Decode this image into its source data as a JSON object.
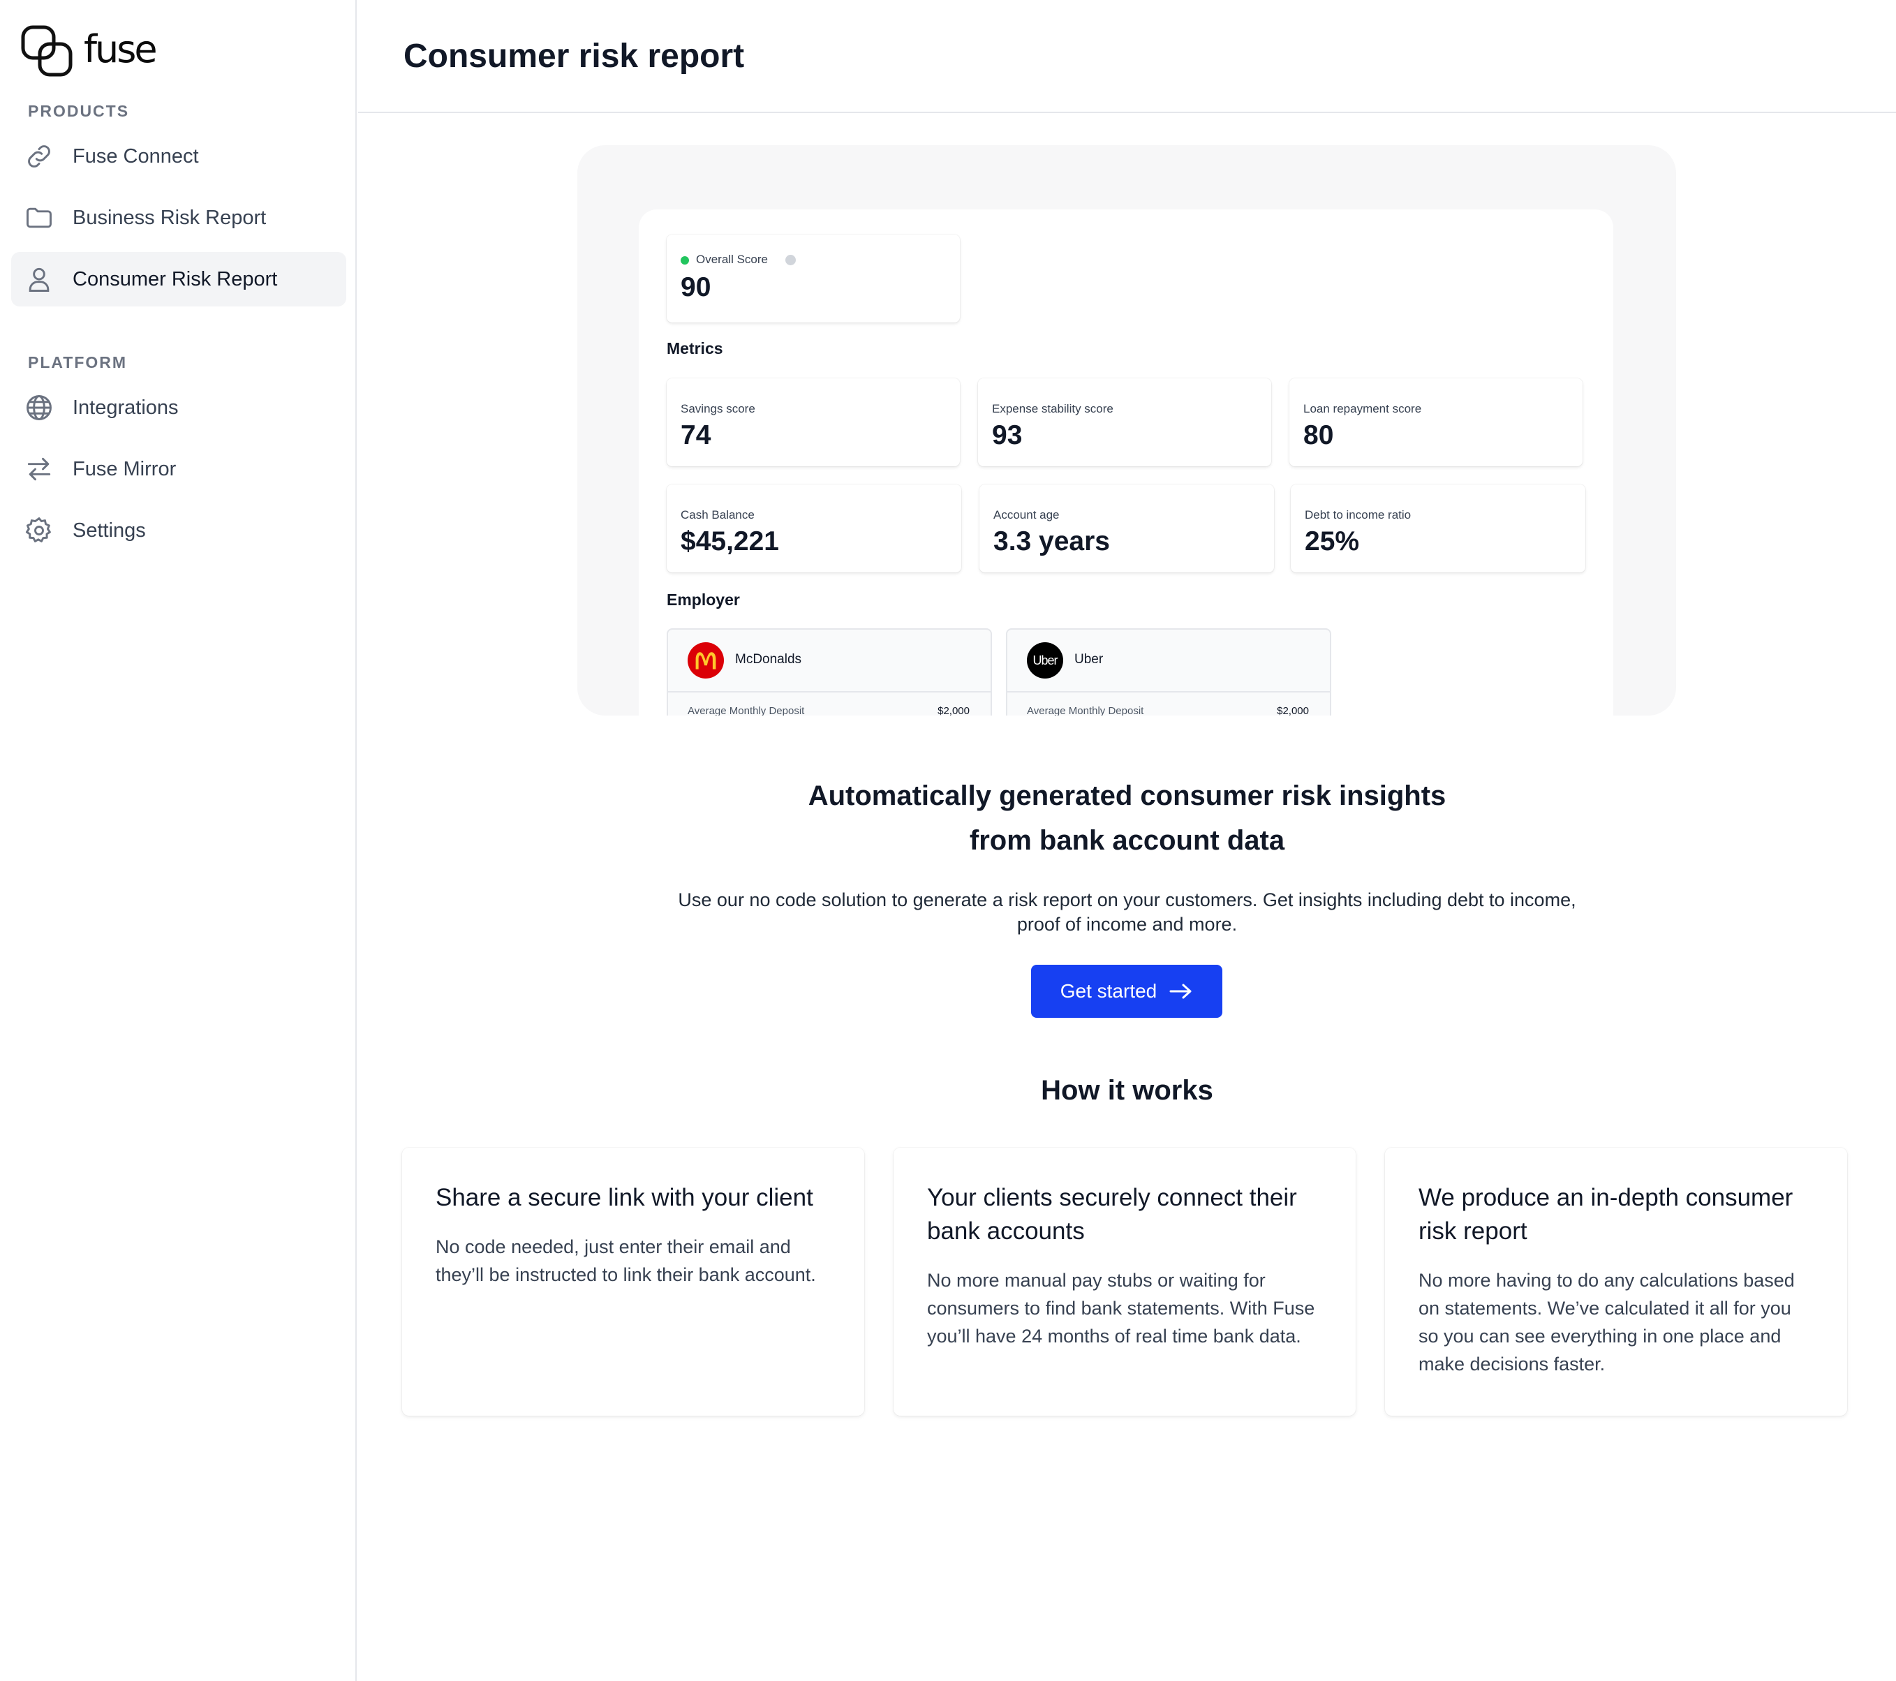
{
  "brand": {
    "name": "fuse"
  },
  "sidebar": {
    "sections": [
      {
        "label": "PRODUCTS",
        "items": [
          {
            "label": "Fuse Connect",
            "icon": "link-icon",
            "active": false
          },
          {
            "label": "Business Risk Report",
            "icon": "folder-icon",
            "active": false
          },
          {
            "label": "Consumer Risk Report",
            "icon": "user-icon",
            "active": true
          }
        ]
      },
      {
        "label": "PLATFORM",
        "items": [
          {
            "label": "Integrations",
            "icon": "globe-icon",
            "active": false
          },
          {
            "label": "Fuse Mirror",
            "icon": "arrows-swap-icon",
            "active": false
          },
          {
            "label": "Settings",
            "icon": "gear-icon",
            "active": false
          }
        ]
      }
    ]
  },
  "header": {
    "title": "Consumer risk report"
  },
  "preview": {
    "overall_score": {
      "label": "Overall Score",
      "value": "90",
      "status_color": "#22c55e"
    },
    "metrics_title": "Metrics",
    "metrics": [
      {
        "label": "Savings score",
        "value": "74"
      },
      {
        "label": "Expense stability score",
        "value": "93"
      },
      {
        "label": "Loan repayment score",
        "value": "80"
      },
      {
        "label": "Cash Balance",
        "value": "$45,221"
      },
      {
        "label": "Account age",
        "value": "3.3 years"
      },
      {
        "label": "Debt to income ratio",
        "value": "25%"
      }
    ],
    "employer_title": "Employer",
    "employers": [
      {
        "name": "McDonalds",
        "logo_text": "M",
        "logo_color": "#db0007",
        "deposit_label": "Average Monthly Deposit",
        "deposit_value": "$2,000"
      },
      {
        "name": "Uber",
        "logo_text": "Uber",
        "logo_color": "#000000",
        "deposit_label": "Average Monthly Deposit",
        "deposit_value": "$2,000"
      }
    ]
  },
  "hero": {
    "headline_line1": "Automatically generated consumer risk insights",
    "headline_line2": "from bank account data",
    "subtext_line1": "Use our no code solution to generate a risk report on your customers. Get insights including debt to income,",
    "subtext_line2": "proof of income and more.",
    "cta_label": "Get started",
    "cta_color": "#1740f2"
  },
  "how_it_works": {
    "title": "How it works",
    "steps": [
      {
        "title": "Share a secure link with your client",
        "body": "No code needed, just enter their email and they’ll be instructed to link their bank account."
      },
      {
        "title": "Your clients securely connect their bank accounts",
        "body": "No more manual pay stubs or waiting for consumers to find bank statements. With Fuse you’ll have 24 months of real time bank data."
      },
      {
        "title": "We produce an in-depth consumer risk report",
        "body": "No more having to do any calculations based on statements. We’ve calculated it all for you so you can see everything in one place and make decisions faster."
      }
    ]
  }
}
